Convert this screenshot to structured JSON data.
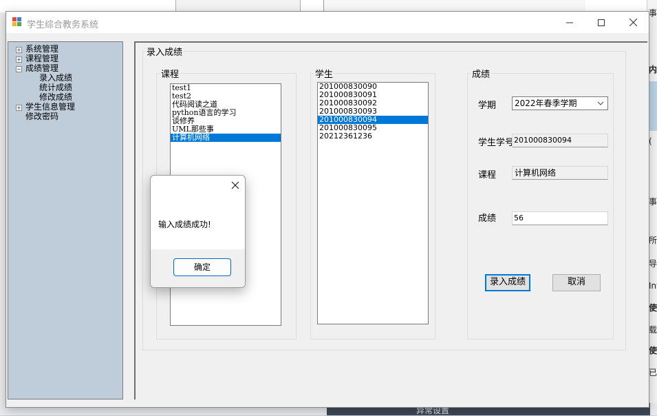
{
  "window": {
    "title": "学生综合教务系统"
  },
  "tree": {
    "items": [
      {
        "label": "系统管理",
        "expander": "+"
      },
      {
        "label": "课程管理",
        "expander": "+"
      },
      {
        "label": "成绩管理",
        "expander": "−"
      },
      {
        "label": "录入成绩"
      },
      {
        "label": "统计成绩"
      },
      {
        "label": "修改成绩"
      },
      {
        "label": "学生信息管理",
        "expander": "+"
      },
      {
        "label": "修改密码"
      }
    ]
  },
  "panel": {
    "title": "录入成绩",
    "course_group": {
      "label": "课程",
      "items": [
        "test1",
        "test2",
        "代码阅读之道",
        "python语言的学习",
        "谈修养",
        "UML那些事",
        "计算机网络"
      ],
      "selected_index": 6
    },
    "student_group": {
      "label": "学生",
      "items": [
        "201000830090",
        "201000830091",
        "201000830092",
        "201000830093",
        "201000830094",
        "201000830095",
        "20212361236"
      ],
      "selected_index": 4
    },
    "grade_group": {
      "label": "成绩",
      "term_label": "学期",
      "term_value": "2022年春季学期",
      "student_id_label": "学生学号",
      "student_id_value": "201000830094",
      "course_label": "课程",
      "course_value": "计算机网络",
      "score_label": "成绩",
      "score_value": "56",
      "submit_label": "录入成绩",
      "cancel_label": "取消"
    }
  },
  "dialog": {
    "message": "输入成绩成功!",
    "ok_label": "确定"
  },
  "background": {
    "bottom_text": "异常设置",
    "right_fragments": [
      "事件",
      "内",
      "(",
      "事",
      "所有",
      "导岀",
      "Int",
      "使用",
      "载随",
      "使用",
      "已装"
    ]
  },
  "colors": {
    "selection": "#0078d7",
    "tree_bg": "#bfcddb",
    "dialog_ok_border": "#0067c0"
  }
}
